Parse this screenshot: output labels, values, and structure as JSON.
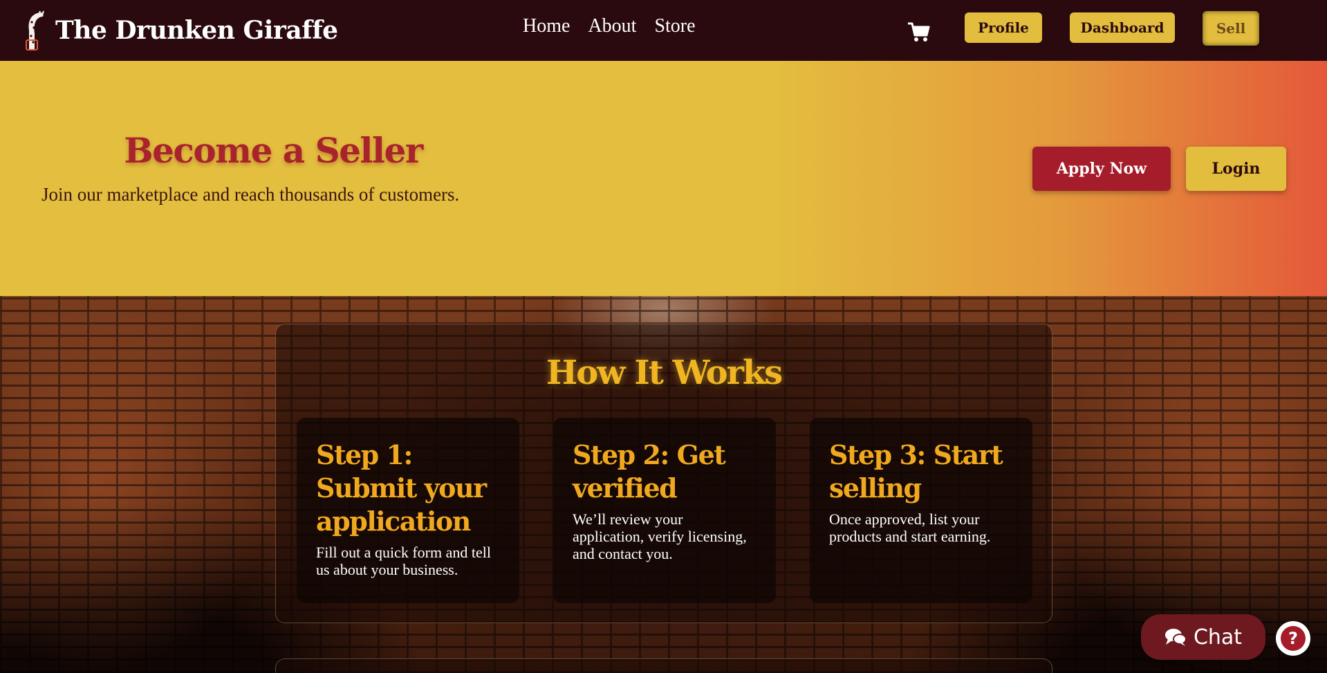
{
  "brand": {
    "name": "The Drunken Giraffe",
    "logo_icon": "giraffe-logo-icon"
  },
  "nav": {
    "links": [
      "Home",
      "About",
      "Store"
    ],
    "cart_icon": "shopping-cart-icon",
    "buttons": {
      "profile": "Profile",
      "dashboard": "Dashboard",
      "sell": "Sell"
    }
  },
  "hero": {
    "title": "Become a Seller",
    "subtitle": "Join our marketplace and reach thousands of customers.",
    "apply_label": "Apply Now",
    "login_label": "Login"
  },
  "how_it_works": {
    "title": "How It Works",
    "steps": [
      {
        "title": "Step 1: Submit your application",
        "description": "Fill out a quick form and tell us about your business."
      },
      {
        "title": "Step 2: Get verified",
        "description": "We’ll review your application, verify licensing, and contact you."
      },
      {
        "title": "Step 3: Start selling",
        "description": "Once approved, list your products and start earning."
      }
    ]
  },
  "chat": {
    "label": "Chat",
    "icon": "chat-bubbles-icon",
    "help_icon": "question-icon",
    "help_glyph": "?"
  },
  "colors": {
    "nav_bg": "#2a0a0f",
    "gold": "#e3bd3e",
    "crimson": "#a51d2a",
    "orange_heading": "#f0a81e"
  }
}
